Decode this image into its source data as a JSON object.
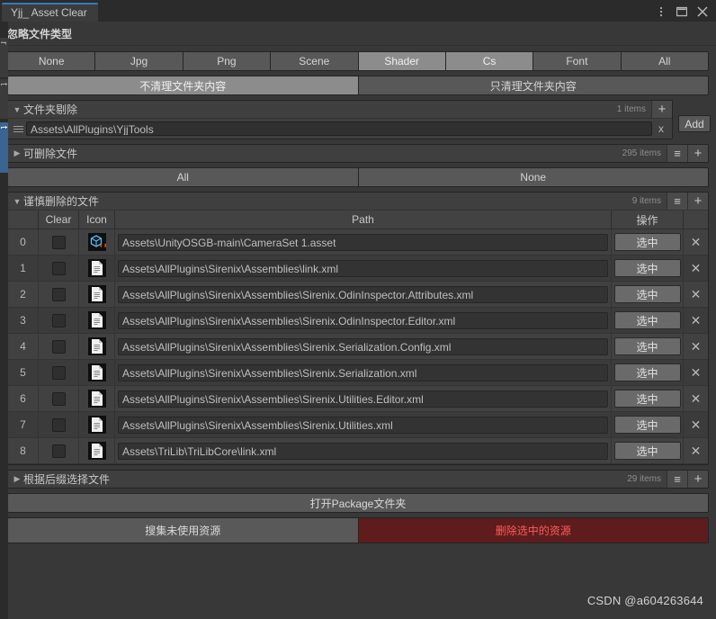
{
  "window": {
    "tab_label": "Yjj_ Asset Clear",
    "menu_icon": "kebab-menu-icon",
    "maximize_icon": "maximize-icon",
    "close_icon": "close-icon"
  },
  "side_tabs": [
    {
      "label": "r",
      "selected": false
    },
    {
      "label": "t",
      "selected": false
    },
    {
      "label": "t",
      "selected": true
    }
  ],
  "ignore_section": {
    "title": "忽略文件类型",
    "types": [
      {
        "label": "None",
        "selected": false
      },
      {
        "label": "Jpg",
        "selected": false
      },
      {
        "label": "Png",
        "selected": false
      },
      {
        "label": "Scene",
        "selected": false
      },
      {
        "label": "Shader",
        "selected": true
      },
      {
        "label": "Cs",
        "selected": true
      },
      {
        "label": "Font",
        "selected": false
      },
      {
        "label": "All",
        "selected": false
      }
    ]
  },
  "folder_mode": {
    "options": [
      {
        "label": "不清理文件夹内容",
        "selected": true
      },
      {
        "label": "只清理文件夹内容",
        "selected": false
      }
    ]
  },
  "folder_exclude": {
    "title": "文件夹剔除",
    "expanded": true,
    "arrow": "▼",
    "count": "1 items",
    "list_icon": "list-menu-icon",
    "plus_icon": "plus-icon",
    "add_label": "Add",
    "rows": [
      {
        "value": "Assets\\AllPlugins\\YjjTools",
        "remove": "x"
      }
    ]
  },
  "deletable_files": {
    "title": "可删除文件",
    "expanded": false,
    "arrow": "▶",
    "count": "295 items",
    "list_icon": "list-menu-icon",
    "plus_icon": "plus-icon"
  },
  "select_bar": {
    "options": [
      {
        "label": "All",
        "selected": false
      },
      {
        "label": "None",
        "selected": false
      }
    ]
  },
  "careful_delete": {
    "title": "谨慎删除的文件",
    "expanded": true,
    "arrow": "▼",
    "count": "9 items",
    "list_icon": "list-menu-icon",
    "plus_icon": "plus-icon",
    "columns": [
      "",
      "Clear",
      "Icon",
      "Path",
      "操作",
      ""
    ],
    "row_action_label": "选中",
    "row_delete_label": "✕",
    "rows": [
      {
        "index": "0",
        "checked": false,
        "icon": "scriptable-object-asset-icon",
        "path": "Assets\\UnityOSGB-main\\CameraSet 1.asset"
      },
      {
        "index": "1",
        "checked": false,
        "icon": "text-document-icon",
        "path": "Assets\\AllPlugins\\Sirenix\\Assemblies\\link.xml"
      },
      {
        "index": "2",
        "checked": false,
        "icon": "text-document-icon",
        "path": "Assets\\AllPlugins\\Sirenix\\Assemblies\\Sirenix.OdinInspector.Attributes.xml"
      },
      {
        "index": "3",
        "checked": false,
        "icon": "text-document-icon",
        "path": "Assets\\AllPlugins\\Sirenix\\Assemblies\\Sirenix.OdinInspector.Editor.xml"
      },
      {
        "index": "4",
        "checked": false,
        "icon": "text-document-icon",
        "path": "Assets\\AllPlugins\\Sirenix\\Assemblies\\Sirenix.Serialization.Config.xml"
      },
      {
        "index": "5",
        "checked": false,
        "icon": "text-document-icon",
        "path": "Assets\\AllPlugins\\Sirenix\\Assemblies\\Sirenix.Serialization.xml"
      },
      {
        "index": "6",
        "checked": false,
        "icon": "text-document-icon",
        "path": "Assets\\AllPlugins\\Sirenix\\Assemblies\\Sirenix.Utilities.Editor.xml"
      },
      {
        "index": "7",
        "checked": false,
        "icon": "text-document-icon",
        "path": "Assets\\AllPlugins\\Sirenix\\Assemblies\\Sirenix.Utilities.xml"
      },
      {
        "index": "8",
        "checked": false,
        "icon": "text-document-icon",
        "path": "Assets\\TriLib\\TriLibCore\\link.xml"
      }
    ]
  },
  "suffix_select": {
    "title": "根据后缀选择文件",
    "expanded": false,
    "arrow": "▶",
    "count": "29 items",
    "list_icon": "list-menu-icon",
    "plus_icon": "plus-icon"
  },
  "actions": {
    "open_package": "打开Package文件夹",
    "collect_unused": "搜集未使用资源",
    "delete_selected": "删除选中的资源"
  },
  "watermark": "CSDN @a604263644",
  "colors": {
    "background": "#383838",
    "panel": "#3f3f3f",
    "button": "#585858",
    "button_selected": "#8c8c8c",
    "accent_blue": "#3a79bd",
    "danger_bg": "#5e1c1c",
    "danger_text": "#ff5c5c"
  }
}
